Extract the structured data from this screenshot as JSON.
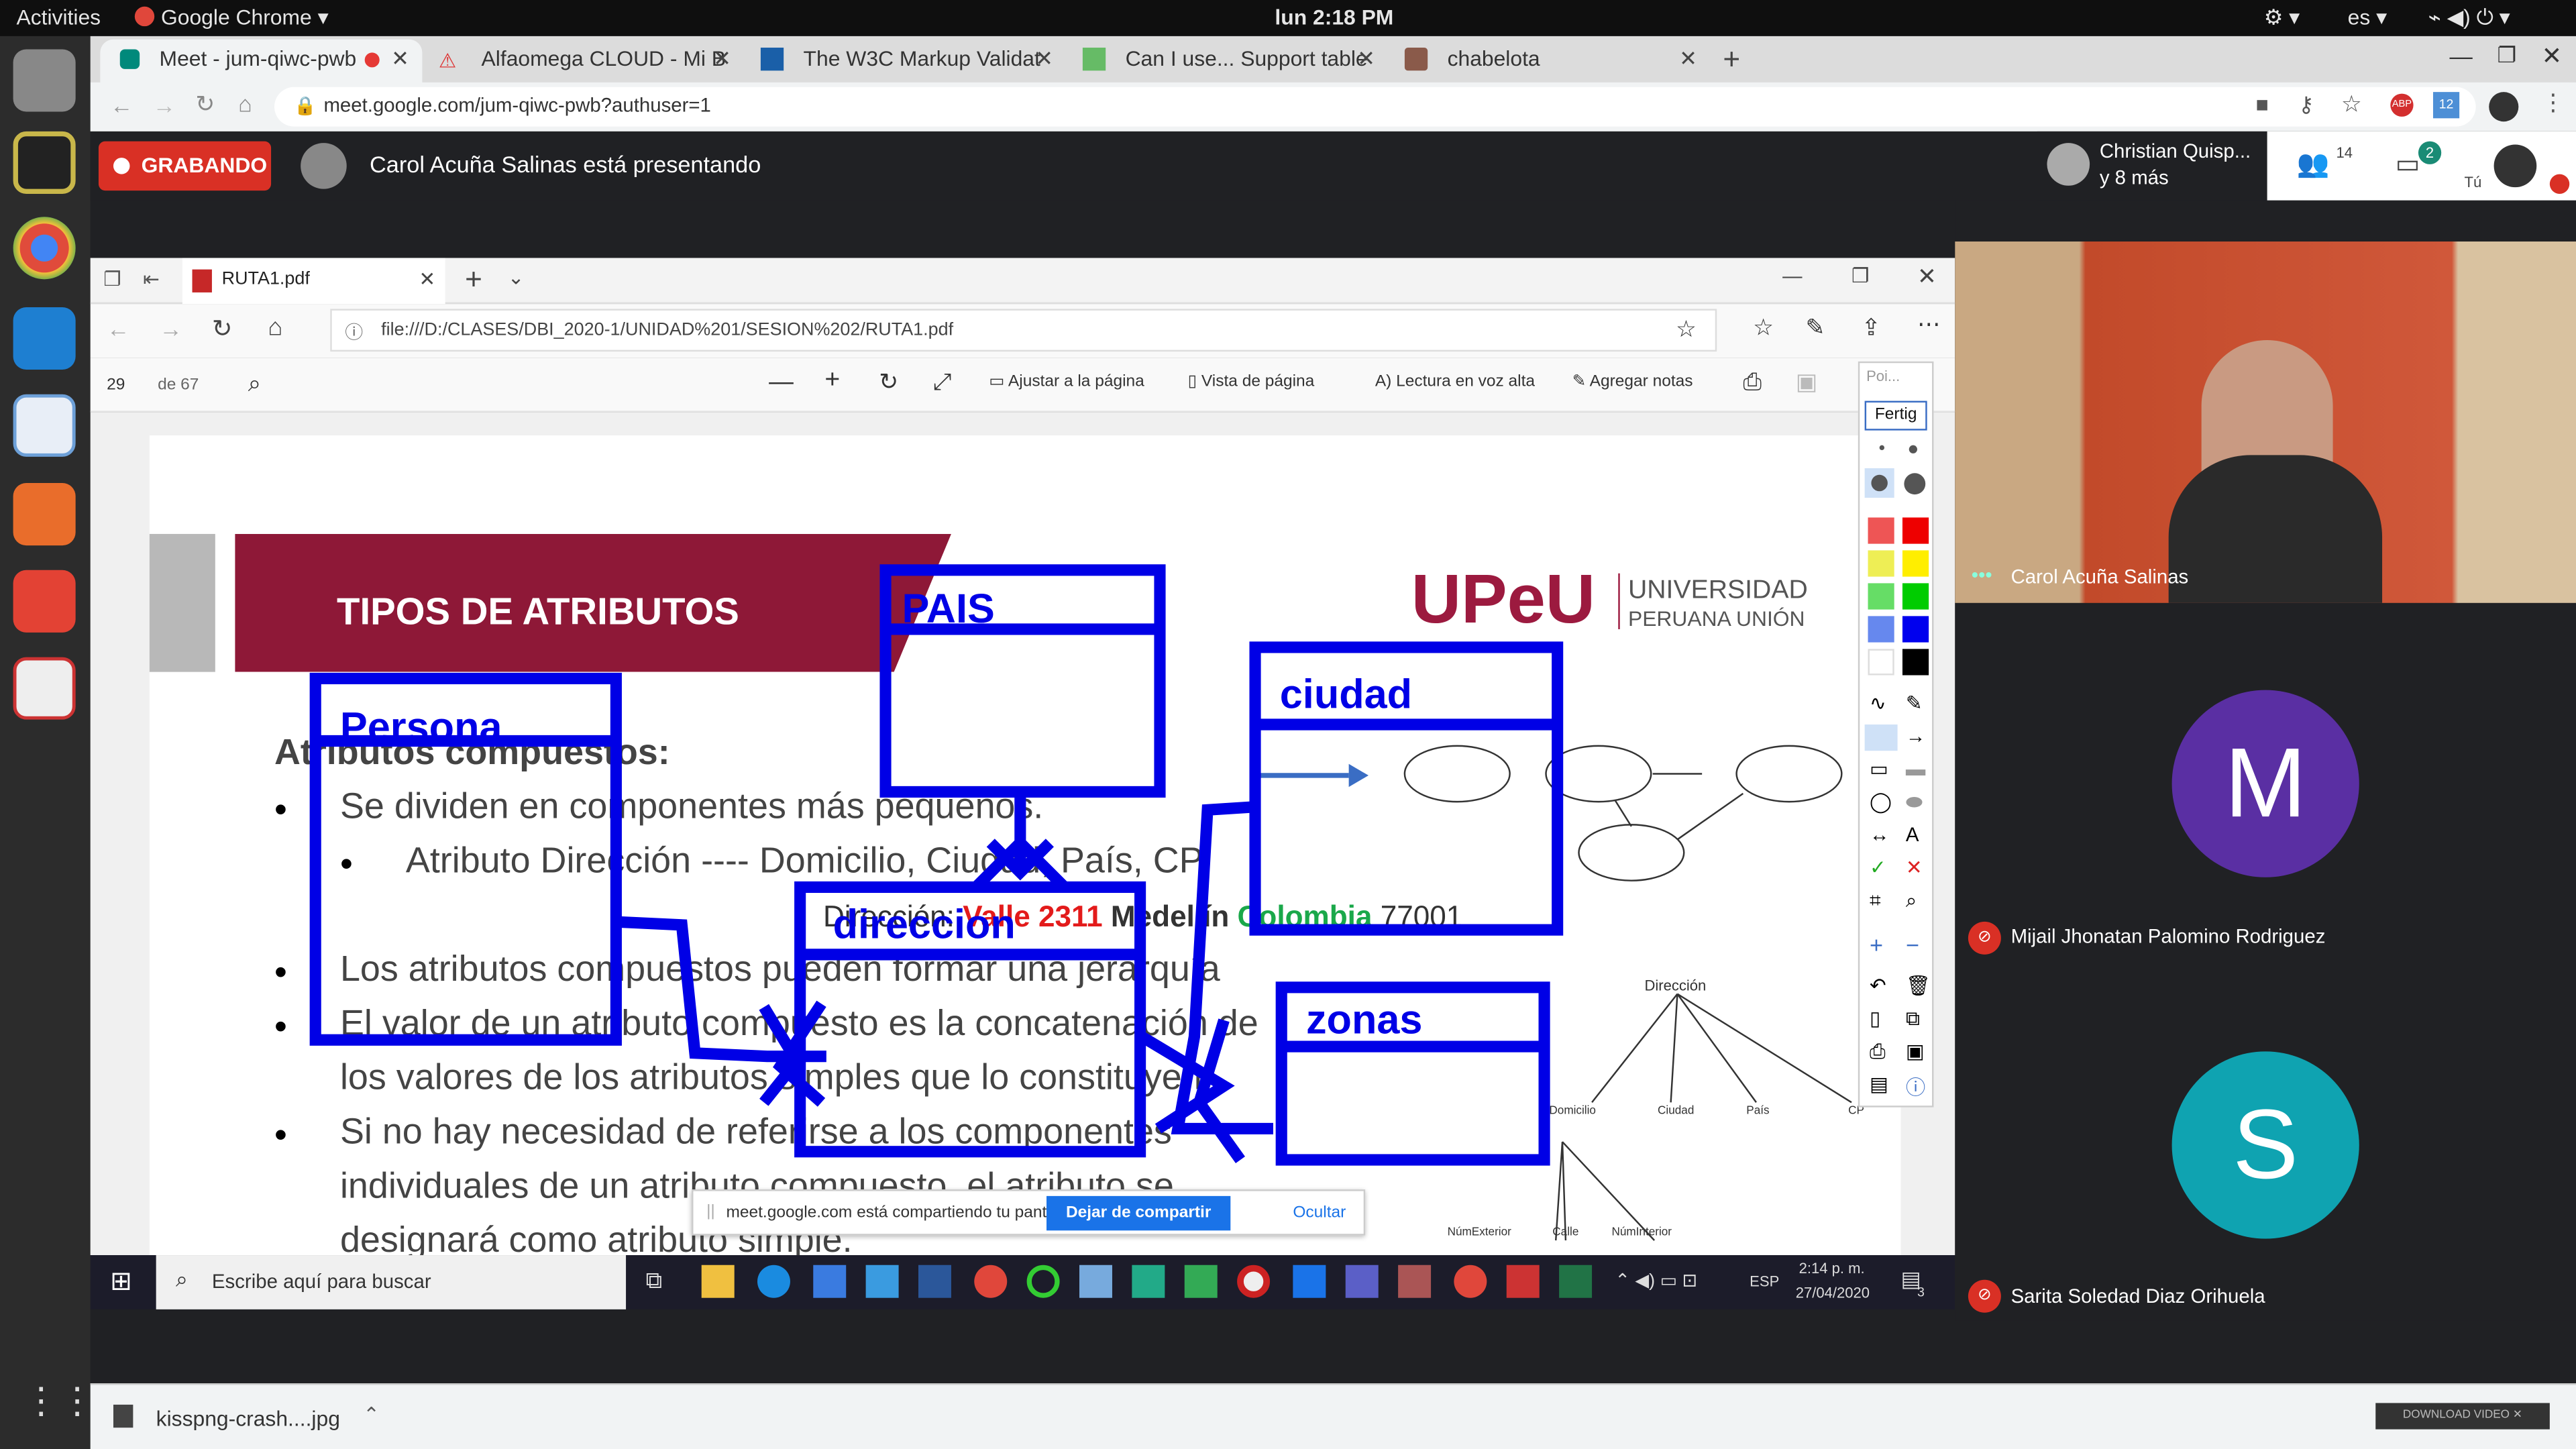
{
  "topbar": {
    "activities": "Activities",
    "app": "Google Chrome",
    "clock": "lun  2:18 PM",
    "lang": "es"
  },
  "chrome": {
    "tabs": [
      {
        "title": "Meet - jum-qiwc-pwb"
      },
      {
        "title": "Alfaomega CLOUD - Mi B"
      },
      {
        "title": "The W3C Markup Validat"
      },
      {
        "title": "Can I use... Support table"
      },
      {
        "title": "chabelota"
      }
    ],
    "url": "meet.google.com/jum-qiwc-pwb?authuser=1",
    "ext_badge": "12"
  },
  "meet": {
    "recording": "GRABANDO",
    "presenting": "Carol Acuña Salinas está presentando",
    "user_line1": "Christian Quisp...",
    "user_line2": "y 8 más",
    "people_count": "14",
    "chat_count": "2",
    "you": "Tú",
    "participants": [
      {
        "name": "Carol Acuña Salinas",
        "initial": "",
        "color": "#b5442c"
      },
      {
        "name": "Mijail Jhonatan Palomino Rodriguez",
        "initial": "M",
        "color": "#5a2fa3"
      },
      {
        "name": "Sarita Soledad Diaz Orihuela",
        "initial": "S",
        "color": "#0fa3b1"
      }
    ],
    "share_notice": "meet.google.com está compartiendo tu pantalla.",
    "stop_share": "Dejar de compartir",
    "hide": "Ocultar"
  },
  "edge": {
    "tab": "RUTA1.pdf",
    "url": "file:///D:/CLASES/DBI_2020-1/UNIDAD%201/SESION%202/RUTA1.pdf",
    "page_num": "29",
    "page_total": "de 67",
    "fit": "Ajustar a la página",
    "view": "Vista de página",
    "read": "Lectura en voz alta",
    "notes": "Agregar notas"
  },
  "slide": {
    "title": "TIPOS DE ATRIBUTOS",
    "logo": "UPeU",
    "uni1": "UNIVERSIDAD",
    "uni2": "PERUANA UNIÓN",
    "heading": "Atributos compuestos:",
    "lines": [
      "Se dividen en componentes más pequeños.",
      "Atributo Dirección  ---- Domicilio, Ciudad, País, CP",
      "Los atributos compuestos pueden formar una jerarquía",
      "El valor de un atributo compuesto es la concatenación de",
      "los valores de los atributos simples que lo constituyen.",
      "Si no hay necesidad de referirse a los componentes",
      "individuales de un atributo compuesto, el atributo se",
      "designará como atributo simple."
    ],
    "ex_prefix": "Dirección:",
    "ex_street": "Valle 2311",
    "ex_city": "Medellín",
    "ex_country": "Colombia",
    "ex_cp": "77001",
    "tree_root": "Dirección",
    "tree_leaves": [
      "Domicilio",
      "Ciudad",
      "País",
      "CP"
    ],
    "tree_sub": [
      "NúmExterior",
      "Calle",
      "NúmInterior"
    ]
  },
  "drawing": {
    "boxes": [
      "Persona",
      "PAIS",
      "ciudad",
      "direccion",
      "zonas"
    ],
    "color": "#0000e6"
  },
  "annot": {
    "search": "Poi...",
    "done": "Fertig"
  },
  "windows": {
    "search": "Escribe aquí para buscar",
    "time": "2:14 p. m.",
    "date": "27/04/2020",
    "lang": "ESP",
    "notif": "3"
  },
  "download": {
    "file": "kisspng-crash....jpg",
    "btn": "DOWNLOAD VIDEO"
  }
}
